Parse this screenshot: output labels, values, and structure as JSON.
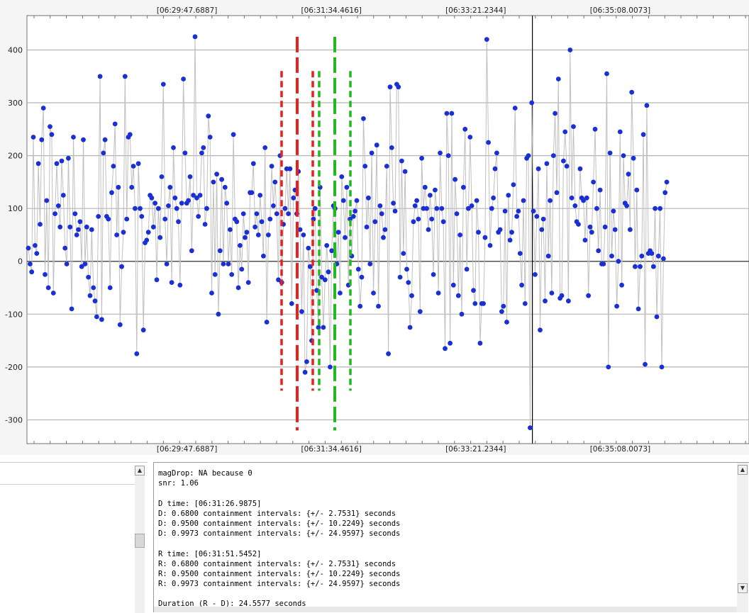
{
  "chart_data": {
    "type": "scatter",
    "subtype": "time-series with connecting lines",
    "title": "",
    "xlabel": "",
    "ylabel": "",
    "x_tick_labels": [
      "[06:29:47.6887]",
      "[06:31:34.4616]",
      "[06:33:21.2344]",
      "[06:35:08.0073]"
    ],
    "x_tick_positions": [
      0.2,
      0.4,
      0.6,
      0.8
    ],
    "y_ticks": [
      400,
      300,
      200,
      100,
      0,
      -100,
      -200,
      -300
    ],
    "ylim": [
      -345,
      465
    ],
    "grid": true,
    "point_color": "#1a2fd4",
    "line_color": "#c0c0c0",
    "series": [
      {
        "values": [
          25,
          -5,
          -20,
          235,
          30,
          15,
          185,
          70,
          230,
          290,
          -25,
          115,
          -50,
          255,
          240,
          -60,
          90,
          185,
          105,
          65,
          190,
          125,
          25,
          -5,
          195,
          65,
          -90,
          235,
          90,
          50,
          60,
          75,
          -10,
          230,
          -5,
          65,
          -30,
          -65,
          60,
          -50,
          -75,
          -105,
          85,
          350,
          -110,
          205,
          230,
          85,
          80,
          -50,
          130,
          180,
          260,
          50,
          140,
          -120,
          -10,
          55,
          350,
          80,
          235,
          240,
          140,
          180,
          100,
          -175,
          185,
          100,
          85,
          -130,
          35,
          40,
          55,
          125,
          120,
          65,
          110,
          -35,
          100,
          45,
          160,
          335,
          80,
          -5,
          105,
          140,
          -40,
          215,
          120,
          100,
          75,
          -45,
          110,
          345,
          205,
          110,
          115,
          160,
          20,
          125,
          425,
          120,
          85,
          125,
          205,
          215,
          70,
          100,
          275,
          235,
          -60,
          150,
          -25,
          165,
          -100,
          20,
          155,
          -5,
          140,
          110,
          -5,
          60,
          -25,
          240,
          80,
          75,
          -50,
          30,
          -15,
          90,
          45,
          55,
          -40,
          130,
          130,
          185,
          65,
          90,
          50,
          125,
          75,
          10,
          215,
          -115,
          50,
          80,
          180,
          105,
          150,
          90,
          -35,
          200,
          -40,
          70,
          100,
          175,
          90,
          175,
          -80,
          120,
          135,
          90,
          170,
          60,
          -95,
          50,
          -210,
          -190,
          25,
          -10,
          -150,
          80,
          100,
          -55,
          -125,
          140,
          -30,
          -125,
          -35,
          30,
          -20,
          -200,
          20,
          105,
          100,
          -5,
          55,
          -60,
          160,
          115,
          45,
          140,
          -45,
          80,
          10,
          85,
          95,
          115,
          -15,
          -85,
          -30,
          270,
          180,
          65,
          120,
          -5,
          205,
          -60,
          75,
          220,
          -85,
          105,
          90,
          45,
          60,
          180,
          -175,
          330,
          215,
          110,
          95,
          335,
          330,
          -30,
          190,
          15,
          170,
          -15,
          -40,
          -125,
          -65,
          75,
          105,
          115,
          80,
          -95,
          195,
          100,
          140,
          100,
          60,
          125,
          80,
          -25,
          135,
          100,
          -60,
          205,
          100,
          75,
          -165,
          280,
          200,
          -155,
          280,
          -45,
          155,
          90,
          -65,
          50,
          -100,
          140,
          250,
          -15,
          100,
          235,
          105,
          -55,
          -80,
          115,
          55,
          -155,
          -80,
          -80,
          45,
          420,
          225,
          30,
          100,
          120,
          175,
          205,
          55,
          60,
          -95,
          -85,
          95,
          -115,
          125,
          40,
          55,
          145,
          290,
          85,
          95,
          15,
          -45,
          115,
          -80,
          195,
          200,
          -315,
          300,
          95,
          -25,
          85,
          175,
          -130,
          60,
          80,
          -75,
          185,
          10,
          115,
          -60,
          200,
          280,
          130,
          345,
          -70,
          -65,
          190,
          245,
          180,
          -75,
          400,
          120,
          255,
          105,
          75,
          70,
          175,
          120,
          115,
          40,
          120,
          -65,
          65,
          55,
          150,
          250,
          100,
          20,
          135,
          -5,
          -5,
          65,
          355,
          -200,
          205,
          10,
          95,
          60,
          -85,
          0,
          245,
          -45,
          200,
          110,
          105,
          165,
          60,
          320,
          195,
          -10,
          135,
          -90,
          -10,
          10,
          240,
          -195,
          295,
          15,
          20,
          15,
          -10,
          100,
          -105,
          10,
          100,
          -200,
          5,
          130,
          150
        ]
      }
    ],
    "annotations": [
      {
        "label": "D",
        "color": "#e8211c",
        "style": "long-dash",
        "x": "[06:31:26.9875]",
        "y_range": [
          -320,
          425
        ]
      },
      {
        "label": "D ± 0.6800",
        "color": "#e8211c",
        "style": "dotted",
        "x_offsets_seconds": [
          -10.2249,
          10.2249
        ],
        "y_range": [
          -245,
          360
        ]
      },
      {
        "label": "R",
        "color": "#22b822",
        "style": "long-dash",
        "x": "[06:31:51.5452]",
        "y_range": [
          -320,
          425
        ]
      },
      {
        "label": "R ± 0.6800",
        "color": "#22b822",
        "style": "dotted",
        "x_offsets_seconds": [
          -10.2249,
          10.2249
        ],
        "y_range": [
          -245,
          360
        ]
      },
      {
        "label": "cursor",
        "color": "#000000",
        "style": "solid",
        "x_position_fraction": 0.7
      }
    ]
  },
  "bottom_left_panel": {
    "scroll_up": "▲",
    "scroll_down": "▼"
  },
  "log_panel": {
    "scroll_up": "▲",
    "scroll_down": "▼",
    "lines": [
      "magDrop: NA because 0",
      "snr: 1.06",
      "",
      "D time: [06:31:26.9875]",
      "D: 0.6800 containment intervals: {+/- 2.7531} seconds",
      "D: 0.9500 containment intervals: {+/- 10.2249} seconds",
      "D: 0.9973 containment intervals: {+/- 24.9597} seconds",
      "",
      "R time: [06:31:51.5452]",
      "R: 0.6800 containment intervals: {+/- 2.7531} seconds",
      "R: 0.9500 containment intervals: {+/- 10.2249} seconds",
      "R: 0.9973 containment intervals: {+/- 24.9597} seconds",
      "",
      "Duration (R - D): 24.5577 seconds"
    ]
  }
}
